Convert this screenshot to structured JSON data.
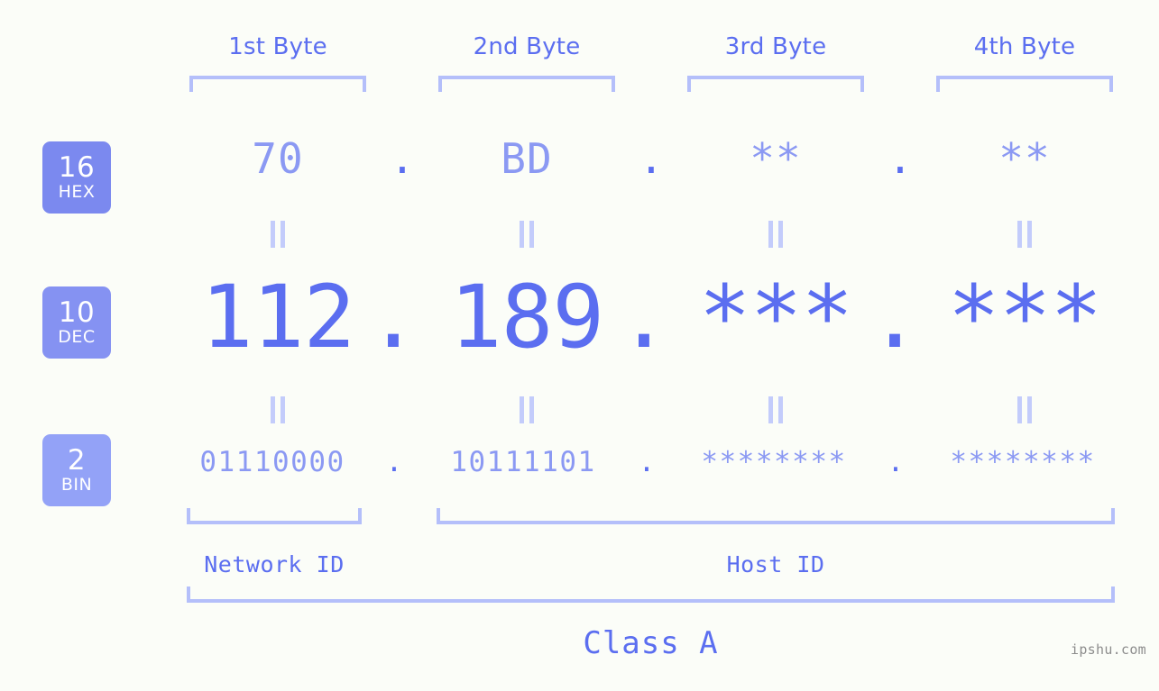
{
  "background_color": "#fbfdf8",
  "accent_color": "#5b6ef0",
  "accent_light": "#8b99f3",
  "bracket_color": "#b4bffa",
  "columns": {
    "headers": [
      {
        "label": "1st Byte"
      },
      {
        "label": "2nd Byte"
      },
      {
        "label": "3rd Byte"
      },
      {
        "label": "4th Byte"
      }
    ]
  },
  "bases": [
    {
      "number": "16",
      "name": "HEX",
      "color": "#7b89ef"
    },
    {
      "number": "10",
      "name": "DEC",
      "color": "#8592f2"
    },
    {
      "number": "2",
      "name": "BIN",
      "color": "#93a2f7"
    }
  ],
  "rows": {
    "hex": {
      "base_number": "16",
      "base_name": "HEX",
      "values": [
        "70",
        "BD",
        "**",
        "**"
      ],
      "separators": [
        ".",
        ".",
        "."
      ]
    },
    "dec": {
      "base_number": "10",
      "base_name": "DEC",
      "values": [
        "112",
        "189",
        "***",
        "***"
      ],
      "separators": [
        ".",
        ".",
        "."
      ]
    },
    "bin": {
      "base_number": "2",
      "base_name": "BIN",
      "values": [
        "01110000",
        "10111101",
        "********",
        "********"
      ],
      "separators": [
        ".",
        ".",
        "."
      ]
    }
  },
  "equals_marks": {
    "glyph": "||",
    "count_per_row": 4
  },
  "segments": {
    "network_id": "Network ID",
    "host_id": "Host ID",
    "class": "Class A"
  },
  "watermark": "ipshu.com"
}
